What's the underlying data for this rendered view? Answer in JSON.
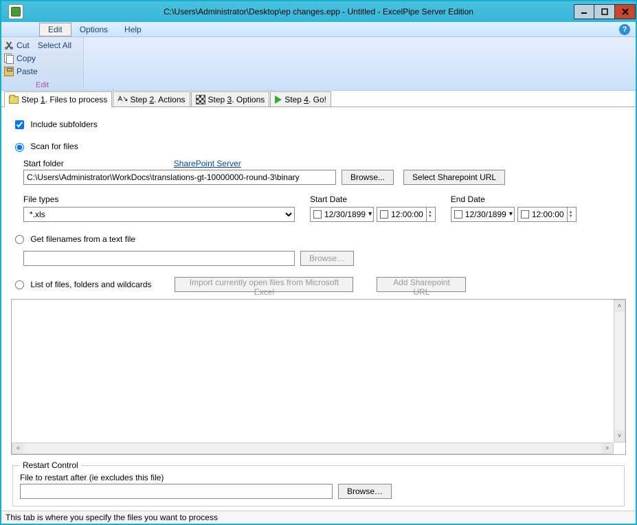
{
  "window": {
    "title": "C:\\Users\\Administrator\\Desktop\\ep changes.epp - Untitled - ExcelPipe Server Edition"
  },
  "menu": {
    "edit": "Edit",
    "options": "Options",
    "help": "Help"
  },
  "ribbon": {
    "cut": "Cut",
    "copy": "Copy",
    "paste": "Paste",
    "select_all": "Select All",
    "group_label": "Edit"
  },
  "tabs": {
    "step1": "Step 1. Files to process",
    "step2": "Step 2. Actions",
    "step3": "Step 3. Options",
    "step4": "Step 4. Go!"
  },
  "form": {
    "include_subfolders": "Include subfolders",
    "scan_for_files": "Scan for files",
    "start_folder_label": "Start folder",
    "sharepoint_link": "SharePoint Server",
    "start_folder_value": "C:\\Users\\Administrator\\WorkDocs\\translations-gt-10000000-round-3\\binary",
    "browse": "Browse...",
    "select_sp_url": "Select Sharepoint URL",
    "file_types_label": "File types",
    "file_types_value": "*.xls",
    "start_date_label": "Start Date",
    "end_date_label": "End Date",
    "date_value": "12/30/1899",
    "time_value": "12:00:00",
    "get_filenames": "Get filenames from a text file",
    "browse2": "Browse…",
    "list_of_files": "List of files, folders and wildcards",
    "import_btn": "Import currently open files from Microsoft Excel",
    "add_sp_url": "Add Sharepoint URL",
    "restart_legend": "Restart Control",
    "restart_label": "File to restart after (ie excludes this file)",
    "browse3": "Browse…"
  },
  "status": "This tab is where you specify the files you want to process"
}
